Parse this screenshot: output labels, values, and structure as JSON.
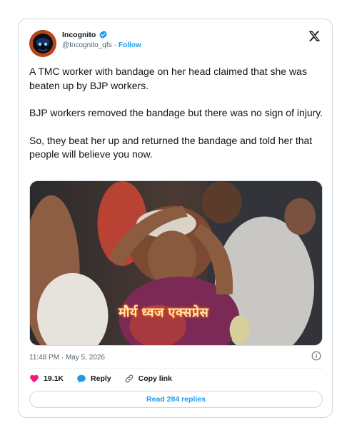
{
  "author": {
    "name": "Incognito",
    "handle": "@Incognito_qfs",
    "separator": "·",
    "follow_label": "Follow"
  },
  "icons": {
    "verified": "verified-badge-icon",
    "platform": "x-logo-icon",
    "info": "info-icon",
    "like": "heart-icon",
    "reply": "reply-bubble-icon",
    "copy": "link-icon"
  },
  "colors": {
    "accent": "#1d9bf0",
    "like": "#f91880",
    "text": "#0f1419",
    "muted": "#536471",
    "border": "#cfd9de"
  },
  "tweet": {
    "paragraphs": [
      "A TMC worker with bandage on her head claimed that she was beaten up by BJP workers.",
      "BJP workers removed the bandage but there was no sign of injury.",
      "So, they beat her up and returned the bandage and told her that people will believe you now."
    ],
    "media_watermark": "मौर्य ध्वज एक्सप्रेस",
    "timestamp": "11:48 PM · May 5, 2026"
  },
  "actions": {
    "like_count": "19.1K",
    "reply_label": "Reply",
    "copy_label": "Copy link"
  },
  "footer": {
    "read_replies_label": "Read 284 replies"
  }
}
